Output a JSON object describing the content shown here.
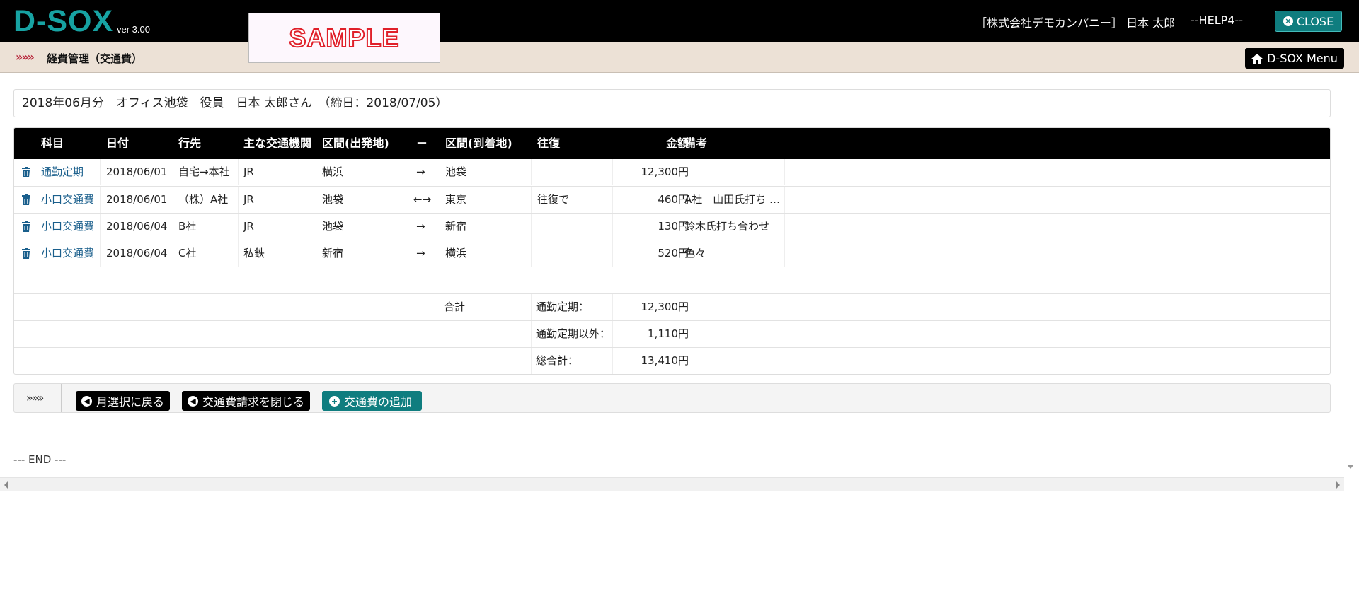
{
  "app": {
    "logo": "D-SOX",
    "version": "ver 3.00",
    "watermark": "SAMPLE"
  },
  "header": {
    "user": "［株式会社デモカンパニー］ 日本 太郎",
    "help": "--HELP4--",
    "close_label": "CLOSE"
  },
  "breadcrumb": {
    "chevrons": "»»»",
    "title": "経費管理（交通費）",
    "menu_label": "D-SOX Menu"
  },
  "summary": "2018年06月分　オフィス池袋　役員　日本 太郎さん　（締日：2018/07/05）",
  "table": {
    "headers": [
      "科目",
      "日付",
      "行先",
      "主な交通機関",
      "区間(出発地)",
      "－",
      "区間(到着地)",
      "往復",
      "金額",
      "備考"
    ],
    "rows": [
      {
        "subject": "通勤定期",
        "date": "2018/06/01",
        "dest": "自宅→本社",
        "transport": "JR",
        "from": "横浜",
        "arrow": "→",
        "to": "池袋",
        "round": "",
        "amount": "12,300円",
        "note": ""
      },
      {
        "subject": "小口交通費",
        "date": "2018/06/01",
        "dest": "（株）A社",
        "transport": "JR",
        "from": "池袋",
        "arrow": "←→",
        "to": "東京",
        "round": "往復で",
        "amount": "460円",
        "note": "A社　山田氏打ち …"
      },
      {
        "subject": "小口交通費",
        "date": "2018/06/04",
        "dest": "B社",
        "transport": "JR",
        "from": "池袋",
        "arrow": "→",
        "to": "新宿",
        "round": "",
        "amount": "130円",
        "note": "鈴木氏打ち合わせ"
      },
      {
        "subject": "小口交通費",
        "date": "2018/06/04",
        "dest": "C社",
        "transport": "私鉄",
        "from": "新宿",
        "arrow": "→",
        "to": "横浜",
        "round": "",
        "amount": "520円",
        "note": "色々"
      }
    ],
    "totals": {
      "label": "合計",
      "commute_label": "通勤定期：",
      "commute_value": "12,300円",
      "other_label": "通勤定期以外：",
      "other_value": "1,110円",
      "grand_label": "総合計：",
      "grand_value": "13,410円"
    }
  },
  "actions": {
    "chevrons": "»»»",
    "back_label": "月選択に戻る",
    "close_request_label": "交通費請求を閉じる",
    "add_label": "交通費の追加"
  },
  "footer": {
    "end": "--- END ---"
  },
  "colors": {
    "logo": "#17a3a3",
    "teal_button": "#0f7d7f",
    "breadcrumb_bg": "#ece1d6",
    "chevron": "#b8283c",
    "link": "#1a5f8c"
  },
  "icons": {
    "close": "times-circle-icon",
    "home": "home-icon",
    "trash": "trash-icon",
    "back": "arrow-circle-left-icon",
    "add": "plus-circle-icon"
  }
}
